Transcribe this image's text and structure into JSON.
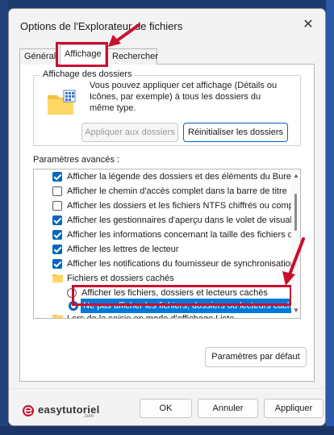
{
  "window": {
    "title": "Options de l'Explorateur de fichiers",
    "close_glyph": "✕"
  },
  "tabs": [
    {
      "label": "Général"
    },
    {
      "label": "Affichage",
      "selected": true
    },
    {
      "label": "Rechercher"
    }
  ],
  "folder_view": {
    "legend": "Affichage des dossiers",
    "description": "Vous pouvez appliquer cet affichage (Détails ou Icônes, par exemple) à tous les dossiers du même type.",
    "apply_button": "Appliquer aux dossiers",
    "reset_button": "Réinitialiser les dossiers"
  },
  "advanced": {
    "label": "Paramètres avancés :",
    "items": [
      {
        "type": "checkbox",
        "checked": true,
        "label": "Afficher la légende des dossiers et des éléments du Burea"
      },
      {
        "type": "checkbox",
        "checked": false,
        "label": "Afficher le chemin d'accès complet dans la barre de titre"
      },
      {
        "type": "checkbox",
        "checked": false,
        "label": "Afficher les dossiers et les fichiers NTFS chiffrés ou comp"
      },
      {
        "type": "checkbox",
        "checked": true,
        "label": "Afficher les gestionnaires d'aperçu dans le volet de visual"
      },
      {
        "type": "checkbox",
        "checked": true,
        "label": "Afficher les informations concernant la taille des fichiers d"
      },
      {
        "type": "checkbox",
        "checked": true,
        "label": "Afficher les lettres de lecteur"
      },
      {
        "type": "checkbox",
        "checked": true,
        "label": "Afficher les notifications du fournisseur de synchronisation"
      },
      {
        "type": "folder",
        "label": "Fichiers et dossiers cachés"
      },
      {
        "type": "radio",
        "checked": false,
        "label": "Afficher les fichiers, dossiers et lecteurs cachés"
      },
      {
        "type": "radio",
        "checked": true,
        "selected": true,
        "label": "Ne pas afficher les fichiers, dossiers ou lecteurs cach"
      },
      {
        "type": "folder",
        "label": "Lors de la saisie en mode d'affichage Liste"
      }
    ]
  },
  "buttons": {
    "defaults": "Paramètres par défaut",
    "ok": "OK",
    "cancel": "Annuler",
    "apply": "Appliquer"
  },
  "watermark": {
    "text": "easytutoriel",
    "sub": ".com"
  },
  "colors": {
    "accent": "#0067c0",
    "selection": "#0078d7",
    "annotation_red": "#c8102e",
    "folder_yellow": "#f5c242"
  }
}
